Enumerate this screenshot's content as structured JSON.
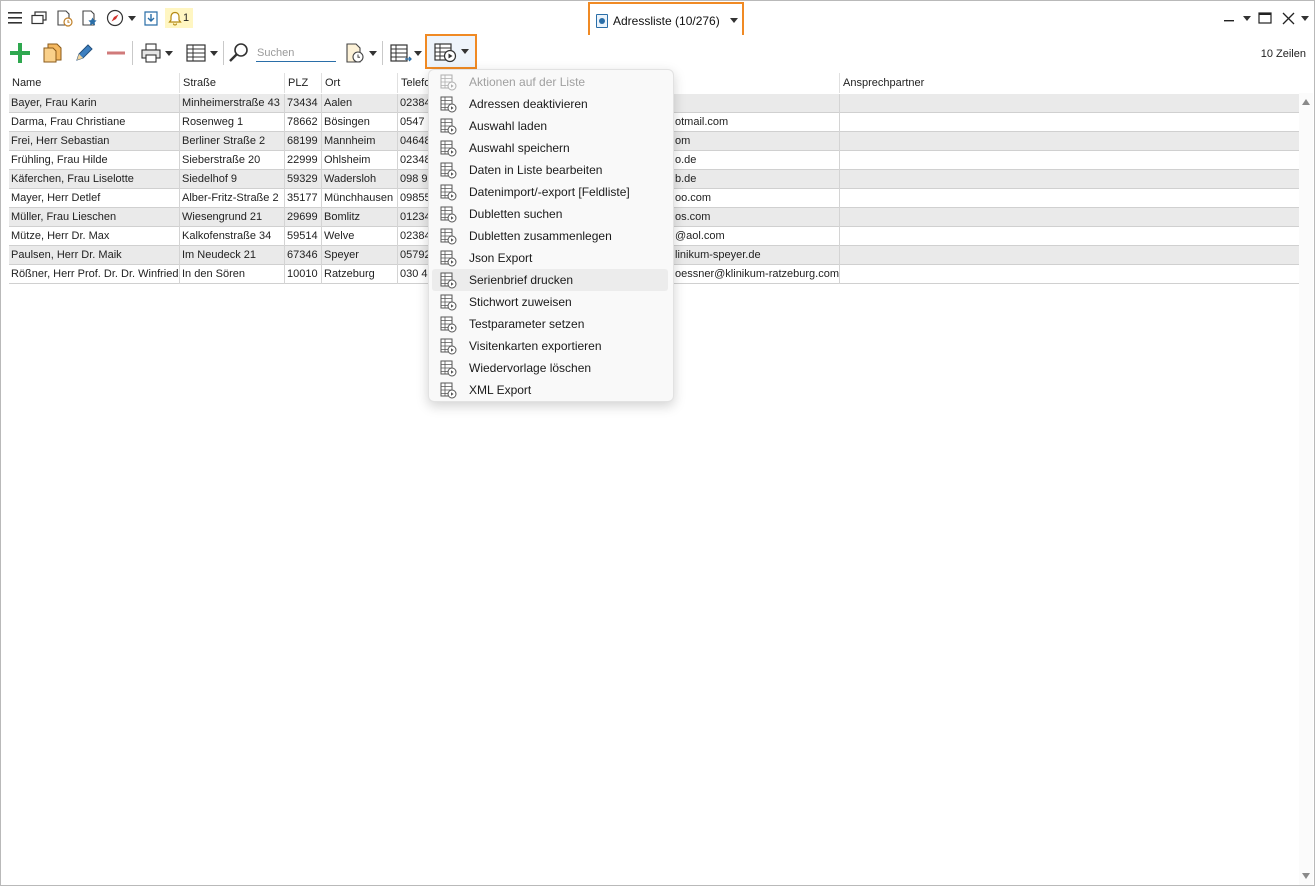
{
  "window": {
    "title": "Adressliste (10/276)",
    "notification_count": "1",
    "row_count": "10 Zeilen"
  },
  "toolbar": {
    "search_placeholder": "Suchen"
  },
  "columns": [
    "Name",
    "Straße",
    "PLZ",
    "Ort",
    "Telefo",
    "",
    "Ansprechpartner"
  ],
  "rows": [
    {
      "name": "Bayer, Frau Karin",
      "strasse": "Minheimerstraße 43",
      "plz": "73434",
      "ort": "Aalen",
      "telefon": "02384",
      "email": ""
    },
    {
      "name": "Darma, Frau Christiane",
      "strasse": "Rosenweg 1",
      "plz": "78662",
      "ort": "Bösingen",
      "telefon": "0547",
      "email": "otmail.com"
    },
    {
      "name": "Frei, Herr Sebastian",
      "strasse": "Berliner Straße 2",
      "plz": "68199",
      "ort": "Mannheim",
      "telefon": "04648",
      "email": "om"
    },
    {
      "name": "Frühling, Frau Hilde",
      "strasse": "Sieberstraße 20",
      "plz": "22999",
      "ort": "Ohlsheim",
      "telefon": "02348",
      "email": "o.de"
    },
    {
      "name": "Käferchen, Frau Liselotte",
      "strasse": "Siedelhof 9",
      "plz": "59329",
      "ort": "Wadersloh",
      "telefon": "098 9",
      "email": "b.de"
    },
    {
      "name": "Mayer, Herr Detlef",
      "strasse": "Alber-Fritz-Straße  2",
      "plz": "35177",
      "ort": "Münchhausen",
      "telefon": "09855",
      "email": "oo.com"
    },
    {
      "name": "Müller, Frau Lieschen",
      "strasse": "Wiesengrund 21",
      "plz": "29699",
      "ort": "Bomlitz",
      "telefon": "01234",
      "email": "os.com"
    },
    {
      "name": "Mütze, Herr Dr. Max",
      "strasse": "Kalkofenstraße 34",
      "plz": "59514",
      "ort": "Welve",
      "telefon": "02384",
      "email": "@aol.com"
    },
    {
      "name": "Paulsen, Herr Dr. Maik",
      "strasse": "Im Neudeck 21",
      "plz": "67346",
      "ort": "Speyer",
      "telefon": "05792",
      "email": "linikum-speyer.de"
    },
    {
      "name": "Rößner, Herr Prof. Dr. Dr. Winfried",
      "strasse": "In den Sören",
      "plz": "10010",
      "ort": "Ratzeburg",
      "telefon": "030 4",
      "email": "oessner@klinikum-ratzeburg.com"
    }
  ],
  "menu": {
    "items": [
      {
        "label": "Aktionen auf der Liste",
        "disabled": true
      },
      {
        "label": "Adressen deaktivieren"
      },
      {
        "label": "Auswahl laden"
      },
      {
        "label": "Auswahl speichern"
      },
      {
        "label": "Daten in Liste bearbeiten"
      },
      {
        "label": "Datenimport/-export [Feldliste]"
      },
      {
        "label": "Dubletten suchen"
      },
      {
        "label": "Dubletten zusammenlegen"
      },
      {
        "label": "Json Export"
      },
      {
        "label": "Serienbrief drucken",
        "highlighted": true
      },
      {
        "label": "Stichwort zuweisen"
      },
      {
        "label": "Testparameter setzen"
      },
      {
        "label": "Visitenkarten exportieren"
      },
      {
        "label": "Wiedervorlage löschen"
      },
      {
        "label": "XML Export"
      }
    ]
  },
  "colors": {
    "accent_outline": "#f08a24",
    "alt_row": "#eaeaea",
    "add_green": "#2fa84f",
    "remove_red": "#c25050"
  }
}
